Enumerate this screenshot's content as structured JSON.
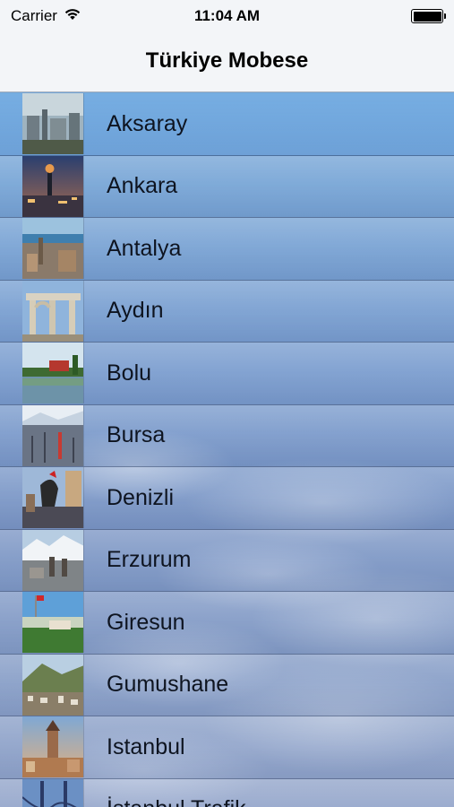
{
  "status_bar": {
    "carrier": "Carrier",
    "time": "11:04 AM",
    "icons": [
      "wifi-icon",
      "battery-icon"
    ]
  },
  "nav": {
    "title": "Türkiye Mobese"
  },
  "cities": [
    {
      "name": "Aksaray",
      "thumb": "aksaray-photo"
    },
    {
      "name": "Ankara",
      "thumb": "ankara-photo"
    },
    {
      "name": "Antalya",
      "thumb": "antalya-photo"
    },
    {
      "name": "Aydın",
      "thumb": "aydin-photo"
    },
    {
      "name": "Bolu",
      "thumb": "bolu-photo"
    },
    {
      "name": "Bursa",
      "thumb": "bursa-photo"
    },
    {
      "name": "Denizli",
      "thumb": "denizli-photo"
    },
    {
      "name": "Erzurum",
      "thumb": "erzurum-photo"
    },
    {
      "name": "Giresun",
      "thumb": "giresun-photo"
    },
    {
      "name": "Gumushane",
      "thumb": "gumushane-photo"
    },
    {
      "name": "Istanbul",
      "thumb": "istanbul-photo"
    },
    {
      "name": "İstanbul Trafik",
      "thumb": "istanbul-trafik-photo"
    }
  ]
}
